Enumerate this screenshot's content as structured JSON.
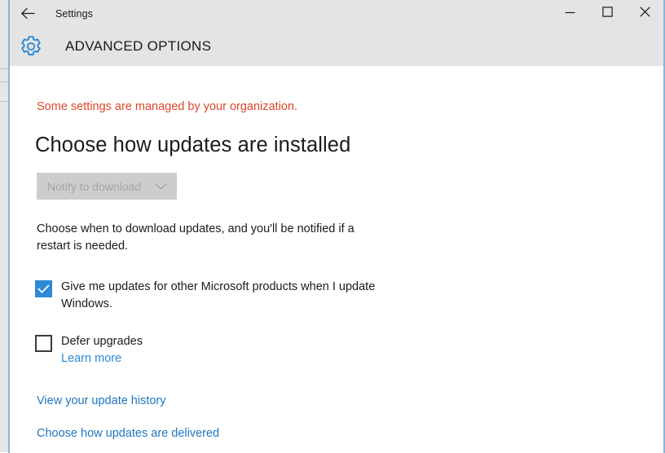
{
  "window": {
    "title_bar": {
      "back_icon": "back-arrow-icon",
      "title": "Settings",
      "controls": {
        "minimize": "minimize-icon",
        "maximize": "maximize-icon",
        "close": "close-icon"
      }
    },
    "header": {
      "icon": "gear-icon",
      "title": "ADVANCED OPTIONS"
    }
  },
  "content": {
    "org_notice": "Some settings are managed by your organization.",
    "heading": "Choose how updates are installed",
    "update_mode": {
      "selected": "Notify to download",
      "icon": "chevron-down-icon",
      "disabled": true
    },
    "description": "Choose when to download updates, and you'll be notified if a restart is needed.",
    "checkboxes": [
      {
        "label": "Give me updates for other Microsoft products when I update Windows.",
        "checked": true
      },
      {
        "label": "Defer upgrades",
        "checked": false
      }
    ],
    "learn_more": "Learn more",
    "links": [
      "View your update history",
      "Choose how updates are delivered"
    ]
  },
  "colors": {
    "accent_blue": "#2e8ad4",
    "link_blue": "#2176bd",
    "warning_red": "#d9472b",
    "header_gray": "#e4e4e4",
    "window_border": "#7fb8e0",
    "disabled_bg": "#cdcdcd",
    "disabled_text": "#a8a3a3"
  }
}
